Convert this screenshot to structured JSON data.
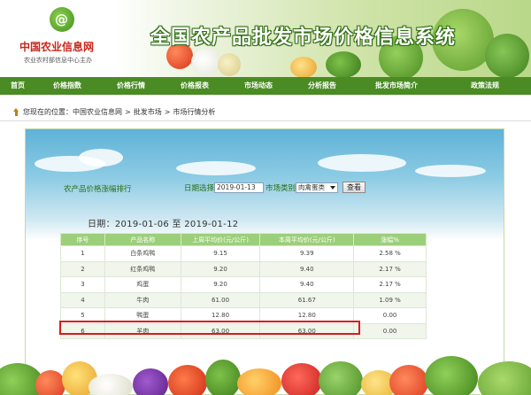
{
  "logo": {
    "mark": "@",
    "name": "中国农业信息网",
    "subtitle": "农业农村部信息中心主办"
  },
  "site_title": "全国农产品批发市场价格信息系统",
  "nav": {
    "items": [
      {
        "label": "首页"
      },
      {
        "label": "价格指数"
      },
      {
        "label": "价格行情"
      },
      {
        "label": "价格报表"
      },
      {
        "label": "市场动态"
      },
      {
        "label": "分析报告"
      },
      {
        "label": "批发市场简介"
      },
      {
        "label": "政策法规"
      }
    ]
  },
  "breadcrumb": {
    "prefix": "您现在的位置：",
    "items": [
      "中国农业信息网",
      "批发市场",
      "市场行情分析"
    ],
    "separator": ">"
  },
  "panel": {
    "title": "农产品价格涨幅排行",
    "date_label": "日期选择",
    "date_value": "2019-01-13",
    "market_label": "市场类别",
    "market_value": "肉禽蛋类",
    "query_label": "查看",
    "period": "日期：2019-01-06 至 2019-01-12"
  },
  "table": {
    "headers": [
      "序号",
      "产品名称",
      "上周平均价(元/公斤)",
      "本周平均价(元/公斤)",
      "涨幅%"
    ],
    "rows": [
      [
        "1",
        "白条鸡鸭",
        "9.15",
        "9.39",
        "2.58 %"
      ],
      [
        "2",
        "红条鸡鸭",
        "9.20",
        "9.40",
        "2.17 %"
      ],
      [
        "3",
        "鸡蛋",
        "9.20",
        "9.40",
        "2.17 %"
      ],
      [
        "4",
        "牛肉",
        "61.00",
        "61.67",
        "1.09 %"
      ],
      [
        "5",
        "鸭蛋",
        "12.80",
        "12.80",
        "0.00"
      ],
      [
        "6",
        "羊肉",
        "63.00",
        "63.00",
        "0.00"
      ]
    ],
    "highlighted_row": 6
  },
  "colors": {
    "nav": "#4a8c23",
    "table_header": "#9ccf7a",
    "highlight": "#d51d1d",
    "logo_red": "#c8261b"
  }
}
